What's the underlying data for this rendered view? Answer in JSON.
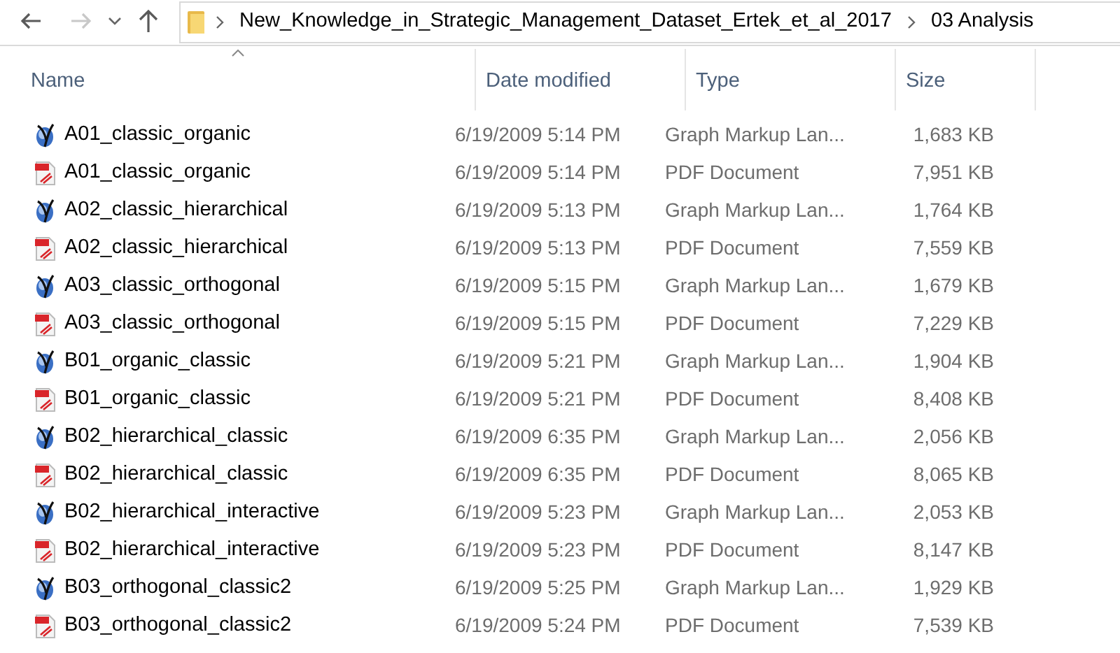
{
  "breadcrumb": [
    "New_Knowledge_in_Strategic_Management_Dataset_Ertek_et_al_2017",
    "03 Analysis"
  ],
  "nav": {
    "back_disabled": false,
    "forward_disabled": true
  },
  "columns": [
    {
      "label": "Name",
      "sorted": true
    },
    {
      "label": "Date modified",
      "sorted": false
    },
    {
      "label": "Type",
      "sorted": false
    },
    {
      "label": "Size",
      "sorted": false
    }
  ],
  "files": [
    {
      "kind": "graphml",
      "name": "A01_classic_organic",
      "date": "6/19/2009 5:14 PM",
      "type": "Graph Markup Lan...",
      "size": "1,683 KB"
    },
    {
      "kind": "pdf",
      "name": "A01_classic_organic",
      "date": "6/19/2009 5:14 PM",
      "type": "PDF Document",
      "size": "7,951 KB"
    },
    {
      "kind": "graphml",
      "name": "A02_classic_hierarchical",
      "date": "6/19/2009 5:13 PM",
      "type": "Graph Markup Lan...",
      "size": "1,764 KB"
    },
    {
      "kind": "pdf",
      "name": "A02_classic_hierarchical",
      "date": "6/19/2009 5:13 PM",
      "type": "PDF Document",
      "size": "7,559 KB"
    },
    {
      "kind": "graphml",
      "name": "A03_classic_orthogonal",
      "date": "6/19/2009 5:15 PM",
      "type": "Graph Markup Lan...",
      "size": "1,679 KB"
    },
    {
      "kind": "pdf",
      "name": "A03_classic_orthogonal",
      "date": "6/19/2009 5:15 PM",
      "type": "PDF Document",
      "size": "7,229 KB"
    },
    {
      "kind": "graphml",
      "name": "B01_organic_classic",
      "date": "6/19/2009 5:21 PM",
      "type": "Graph Markup Lan...",
      "size": "1,904 KB"
    },
    {
      "kind": "pdf",
      "name": "B01_organic_classic",
      "date": "6/19/2009 5:21 PM",
      "type": "PDF Document",
      "size": "8,408 KB"
    },
    {
      "kind": "graphml",
      "name": "B02_hierarchical_classic",
      "date": "6/19/2009 6:35 PM",
      "type": "Graph Markup Lan...",
      "size": "2,056 KB"
    },
    {
      "kind": "pdf",
      "name": "B02_hierarchical_classic",
      "date": "6/19/2009 6:35 PM",
      "type": "PDF Document",
      "size": "8,065 KB"
    },
    {
      "kind": "graphml",
      "name": "B02_hierarchical_interactive",
      "date": "6/19/2009 5:23 PM",
      "type": "Graph Markup Lan...",
      "size": "2,053 KB"
    },
    {
      "kind": "pdf",
      "name": "B02_hierarchical_interactive",
      "date": "6/19/2009 5:23 PM",
      "type": "PDF Document",
      "size": "8,147 KB"
    },
    {
      "kind": "graphml",
      "name": "B03_orthogonal_classic2",
      "date": "6/19/2009 5:25 PM",
      "type": "Graph Markup Lan...",
      "size": "1,929 KB"
    },
    {
      "kind": "pdf",
      "name": "B03_orthogonal_classic2",
      "date": "6/19/2009 5:24 PM",
      "type": "PDF Document",
      "size": "7,539 KB"
    }
  ]
}
